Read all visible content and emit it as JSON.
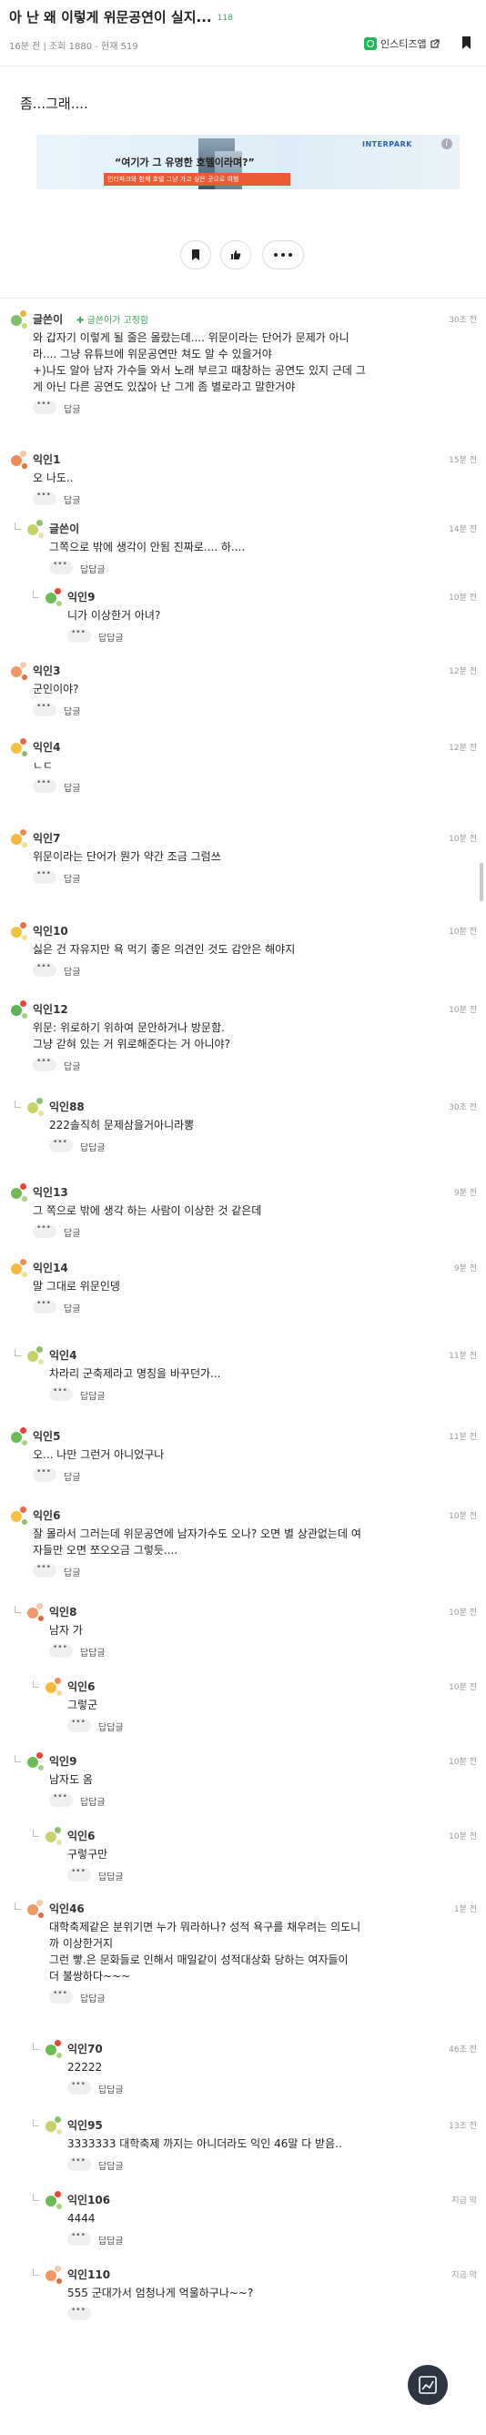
{
  "post": {
    "title": "아 난 왜 이렇게 위문공연이 실지...",
    "comment_count": "118",
    "meta": "16분 전 | 조회 1880 - 현재 519",
    "body": "좀...그래....",
    "insti_label": "인스티즈앱",
    "bookmark_icon": "bookmark-icon"
  },
  "ad": {
    "brand": "INTERPARK",
    "quote": "“여기가 그 유명한 호텔이라며?”",
    "sub": "인터파크와 함께 호텔 그냥 가고 싶은 곳으로 여행",
    "info": "i"
  },
  "comments": [
    {
      "nick": "글쓴이",
      "fixed": "글쓴이가 고정함",
      "time": "30초 전",
      "text": "와 갑자기 이렇게 될 줄은 몰랐는데.... 위문이라는 단어가 문제가 아니\n라.... 그냥 유튜브에 위문공연만 쳐도 알 수 있을거야\n+)나도 알아 남자 가수들 와서 노래 부르고 때창하는 공연도 있지 근데 그\n게 아닌 다른 공연도 있잖아 난 그게 좀 별로라고 말한거야",
      "reply": "답글"
    },
    {
      "nick": "익인1",
      "time": "15분 전",
      "text": "오 나도..",
      "reply": "답글"
    },
    {
      "nick": "글쓴이",
      "time": "14분 전",
      "text": "그쪽으로 밖에 생각이 안됨 진짜로.... 하....",
      "reply": "답답글"
    },
    {
      "nick": "익인9",
      "time": "10분 전",
      "text": "니가 이상한거 아녀?",
      "reply": "답답글"
    },
    {
      "nick": "익인3",
      "time": "12분 전",
      "text": "군인이야?",
      "reply": "답글"
    },
    {
      "nick": "익인4",
      "time": "12분 전",
      "text": "ㄴㄷ",
      "reply": "답글"
    },
    {
      "nick": "익인7",
      "time": "10분 전",
      "text": "위문이라는 단어가 뭔가 약간 조금 그럼쓰",
      "reply": "답글"
    },
    {
      "nick": "익인10",
      "time": "10분 전",
      "text": "싫은 건 자유지만 욕 먹기 좋은 의견인 것도 감안은 해야지",
      "reply": "답글"
    },
    {
      "nick": "익인12",
      "time": "10분 전",
      "text": "위문: 위로하기 위하여 문안하거나 방문함.\n그냥 갇혀 있는 거 위로해준다는 거 아니야?",
      "reply": "답글"
    },
    {
      "nick": "익인88",
      "time": "30초 전",
      "text": "222솔직히 문제삼을거아니라뽕",
      "reply": "답답글"
    },
    {
      "nick": "익인13",
      "time": "9분 전",
      "text": "그 쪽으로 밖에 생각 하는 사람이 이상한 것 같은데",
      "reply": "답글"
    },
    {
      "nick": "익인14",
      "time": "9분 전",
      "text": "말 그대로 위문인뎅",
      "reply": "답글"
    },
    {
      "nick": "익인4",
      "time": "11분 전",
      "text": "차라리 군축제라고 명칭을 바꾸던가...",
      "reply": "답답글"
    },
    {
      "nick": "익인5",
      "time": "11분 전",
      "text": "오... 나만 그런거 아니었구나",
      "reply": "답글"
    },
    {
      "nick": "익인6",
      "time": "10분 전",
      "text": "잘 몰라서 그러는데 위문공연에 남자가수도 오나? 오면 별 상관없는데 여\n자들만 오면 쪼오오금 그렇듯....",
      "reply": "답글"
    },
    {
      "nick": "익인8",
      "time": "10분 전",
      "text": "남자 가",
      "reply": "답답글"
    },
    {
      "nick": "익인6",
      "time": "10분 전",
      "text": "그렇군",
      "reply": "답답글"
    },
    {
      "nick": "익인9",
      "time": "10분 전",
      "text": "남자도 옴",
      "reply": "답답글"
    },
    {
      "nick": "익인6",
      "time": "10분 전",
      "text": "구렇구만",
      "reply": "답답글"
    },
    {
      "nick": "익인46",
      "time": "1분 전",
      "text": "대학축제같은 분위기면 누가 뭐라하나? 성적 욕구를 채우려는 의도니\n까 이상한거지\n그런 빻.은 문화들로 인해서 매일같이 성적대상화 당하는 여자들이\n더 불쌍하다~~~",
      "reply": "답답글"
    },
    {
      "nick": "익인70",
      "time": "46초 전",
      "text": "22222",
      "reply": "답답글"
    },
    {
      "nick": "익인95",
      "time": "13초 전",
      "text": "3333333 대학축제 까지는 아니더라도 익인 46말 다 받음..",
      "reply": "답답글"
    },
    {
      "nick": "익인106",
      "time": "지금 막",
      "text": "4444",
      "reply": "답답글"
    },
    {
      "nick": "익인110",
      "time": "지금 막",
      "text": "555 군대가서 엄청나게 억울하구나~~?",
      "reply": ""
    }
  ]
}
